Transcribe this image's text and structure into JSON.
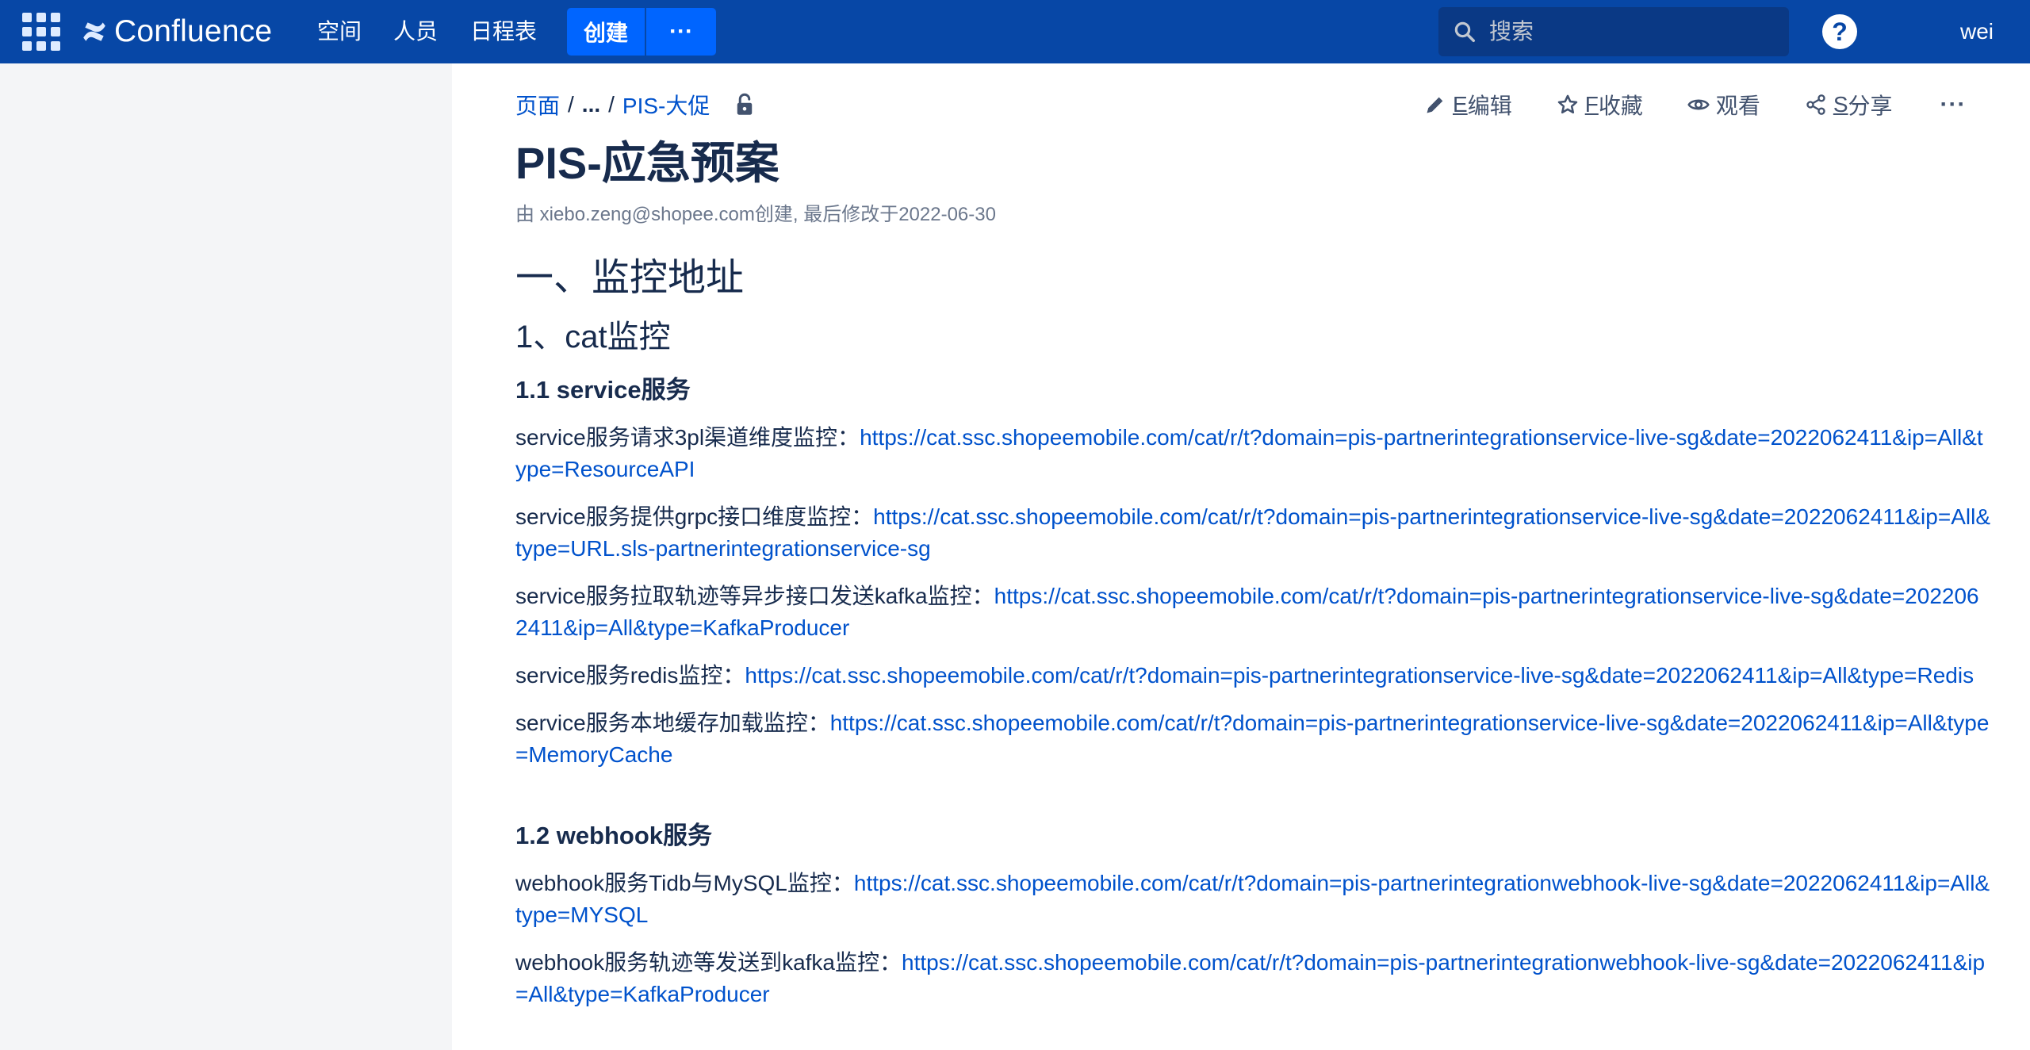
{
  "topbar": {
    "logo_text": "Confluence",
    "nav": [
      {
        "label": "空间"
      },
      {
        "label": "人员"
      },
      {
        "label": "日程表"
      }
    ],
    "create_label": "创建",
    "more_label": "···",
    "search_placeholder": "搜索",
    "help_label": "?",
    "user_label": "wei",
    "colors": {
      "bar": "#0747a6",
      "create": "#0065ff"
    }
  },
  "breadcrumb": {
    "root": "页面",
    "ellipsis": "...",
    "parent": "PIS-大促"
  },
  "actions": {
    "edit": {
      "key": "E",
      "label": "编辑"
    },
    "favorite": {
      "key": "F",
      "label": "收藏"
    },
    "watch": {
      "label": "观看"
    },
    "share": {
      "key": "S",
      "label": "分享"
    },
    "more": "···"
  },
  "page": {
    "title": "PIS-应急预案",
    "byline": "由 xiebo.zeng@shopee.com创建, 最后修改于2022-06-30"
  },
  "content": {
    "h1": "一、监控地址",
    "h2": "1、cat监控",
    "section1_title": "1.1 service服务",
    "section1_items": [
      {
        "label": "service服务请求3pl渠道维度监控：",
        "url": "https://cat.ssc.shopeemobile.com/cat/r/t?domain=pis-partnerintegrationservice-live-sg&date=2022062411&ip=All&type=ResourceAPI"
      },
      {
        "label": "service服务提供grpc接口维度监控：",
        "url": "https://cat.ssc.shopeemobile.com/cat/r/t?domain=pis-partnerintegrationservice-live-sg&date=2022062411&ip=All&type=URL.sls-partnerintegrationservice-sg"
      },
      {
        "label": "service服务拉取轨迹等异步接口发送kafka监控：",
        "url": "https://cat.ssc.shopeemobile.com/cat/r/t?domain=pis-partnerintegrationservice-live-sg&date=2022062411&ip=All&type=KafkaProducer"
      },
      {
        "label": "service服务redis监控：",
        "url": "https://cat.ssc.shopeemobile.com/cat/r/t?domain=pis-partnerintegrationservice-live-sg&date=2022062411&ip=All&type=Redis"
      },
      {
        "label": "service服务本地缓存加载监控：",
        "url": "https://cat.ssc.shopeemobile.com/cat/r/t?domain=pis-partnerintegrationservice-live-sg&date=2022062411&ip=All&type=MemoryCache"
      }
    ],
    "section2_title": "1.2 webhook服务",
    "section2_items": [
      {
        "label": "webhook服务Tidb与MySQL监控：",
        "url": "https://cat.ssc.shopeemobile.com/cat/r/t?domain=pis-partnerintegrationwebhook-live-sg&date=2022062411&ip=All&type=MYSQL"
      },
      {
        "label": "webhook服务轨迹等发送到kafka监控：",
        "url": "https://cat.ssc.shopeemobile.com/cat/r/t?domain=pis-partnerintegrationwebhook-live-sg&date=2022062411&ip=All&type=KafkaProducer"
      }
    ]
  }
}
